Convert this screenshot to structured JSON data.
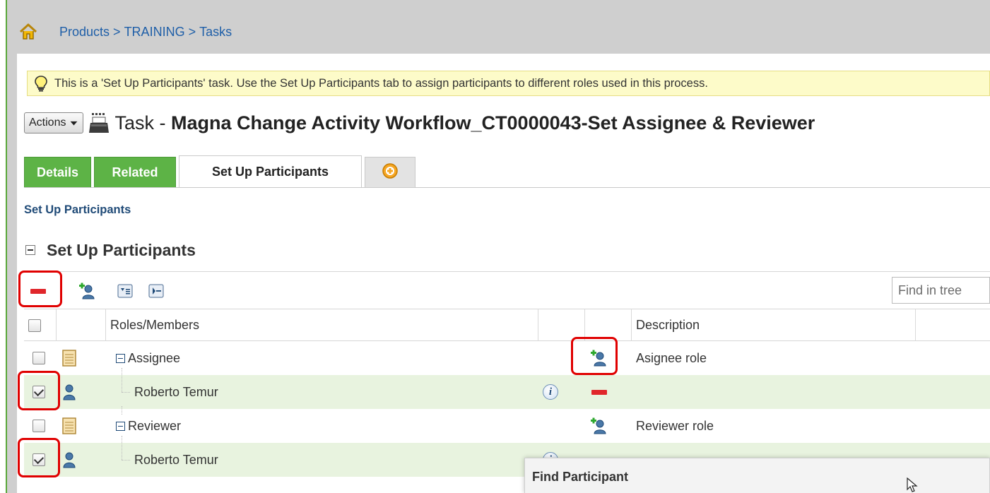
{
  "breadcrumb": {
    "items": [
      "Products",
      "TRAINING",
      "Tasks"
    ],
    "separator": ">"
  },
  "info_bar": {
    "message": "This is a 'Set Up Participants' task. Use the Set Up Participants tab to assign participants to different roles used in this process."
  },
  "header": {
    "actions_label": "Actions",
    "title_prefix": "Task - ",
    "title_name": "Magna Change Activity Workflow_CT0000043-Set Assignee & Reviewer"
  },
  "tabs": [
    {
      "label": "Details",
      "state": "inactive"
    },
    {
      "label": "Related",
      "state": "inactive"
    },
    {
      "label": "Set Up Participants",
      "state": "active"
    }
  ],
  "sub_title": "Set Up Participants",
  "section_title": "Set Up Participants",
  "toolbar": {
    "find_placeholder": "Find in tree"
  },
  "grid": {
    "columns": [
      "Roles/Members",
      "Description"
    ],
    "rows": [
      {
        "type": "role",
        "name": "Assignee",
        "description": "Asignee role",
        "checked": false
      },
      {
        "type": "member",
        "name": "Roberto Temur",
        "description": "",
        "checked": true
      },
      {
        "type": "role",
        "name": "Reviewer",
        "description": "Reviewer role",
        "checked": false
      },
      {
        "type": "member",
        "name": "Roberto Temur",
        "description": "",
        "checked": true
      }
    ]
  },
  "find_dialog": {
    "title": "Find Participant"
  },
  "colors": {
    "tab_green": "#5db346",
    "link_blue": "#1f5fa8",
    "info_bar_bg": "#fdfbc9",
    "member_row_bg": "#e8f3df",
    "highlight_red": "#e00000",
    "remove_red": "#e0262b"
  }
}
